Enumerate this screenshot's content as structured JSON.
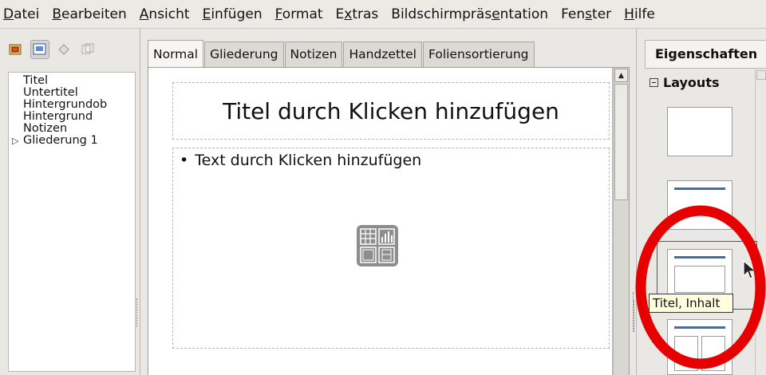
{
  "menubar": {
    "items": [
      "Datei",
      "Bearbeiten",
      "Ansicht",
      "Einfügen",
      "Format",
      "Extras",
      "Bildschirmpräsentation",
      "Fenster",
      "Hilfe"
    ],
    "mnemonic_index": [
      0,
      0,
      0,
      0,
      0,
      1,
      14,
      3,
      0
    ]
  },
  "left_panel": {
    "outline": [
      {
        "label": "Titel",
        "expander": false
      },
      {
        "label": "Untertitel",
        "expander": false
      },
      {
        "label": "Hintergrundob",
        "expander": false
      },
      {
        "label": "Hintergrund",
        "expander": false
      },
      {
        "label": "Notizen",
        "expander": false
      },
      {
        "label": "Gliederung 1",
        "expander": true
      }
    ]
  },
  "tabs": [
    "Normal",
    "Gliederung",
    "Notizen",
    "Handzettel",
    "Foliensortierung"
  ],
  "active_tab": "Normal",
  "slide": {
    "title_placeholder": "Titel durch Klicken hinzufügen",
    "content_bullet": "•",
    "content_placeholder": "Text durch Klicken hinzufügen"
  },
  "right_panel": {
    "header": "Eigenschaften",
    "section": "Layouts",
    "tooltip": "Titel, Inhalt"
  },
  "colors": {
    "annotation_circle": "#e60000",
    "layout_bar": "#3c6eb4"
  }
}
